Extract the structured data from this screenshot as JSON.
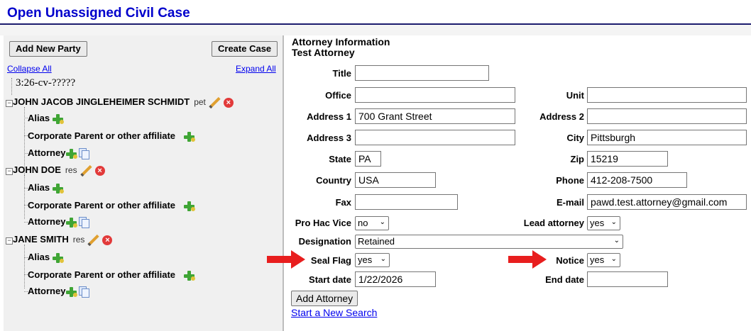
{
  "page": {
    "title": "Open Unassigned Civil Case"
  },
  "left": {
    "add_party_label": "Add New Party",
    "create_case_label": "Create Case",
    "collapse_all": "Collapse All",
    "expand_all": "Expand All",
    "case_number": "3:26-cv-?????",
    "parties": [
      {
        "name": "JOHN JACOB JINGLEHEIMER SCHMIDT",
        "role": "pet",
        "children": [
          "Alias",
          "Corporate Parent or other affiliate",
          "Attorney"
        ]
      },
      {
        "name": "JOHN DOE",
        "role": "res",
        "children": [
          "Alias",
          "Corporate Parent or other affiliate",
          "Attorney"
        ]
      },
      {
        "name": "JANE SMITH",
        "role": "res",
        "children": [
          "Alias",
          "Corporate Parent or other affiliate",
          "Attorney"
        ]
      }
    ]
  },
  "form": {
    "section_title": "Attorney Information",
    "attorney_name": "Test Attorney",
    "title_label": "Title",
    "title_value": "",
    "office_label": "Office",
    "office_value": "",
    "unit_label": "Unit",
    "unit_value": "",
    "address1_label": "Address 1",
    "address1_value": "700 Grant Street",
    "address2_label": "Address 2",
    "address2_value": "",
    "address3_label": "Address 3",
    "address3_value": "",
    "city_label": "City",
    "city_value": "Pittsburgh",
    "state_label": "State",
    "state_value": "PA",
    "zip_label": "Zip",
    "zip_value": "15219",
    "country_label": "Country",
    "country_value": "USA",
    "phone_label": "Phone",
    "phone_value": "412-208-7500",
    "fax_label": "Fax",
    "fax_value": "",
    "email_label": "E-mail",
    "email_value": "pawd.test.attorney@gmail.com",
    "pro_hac_label": "Pro Hac Vice",
    "pro_hac_value": "no",
    "lead_label": "Lead attorney",
    "lead_value": "yes",
    "designation_label": "Designation",
    "designation_value": "Retained",
    "seal_label": "Seal Flag",
    "seal_value": "yes",
    "notice_label": "Notice",
    "notice_value": "yes",
    "start_label": "Start date",
    "start_value": "1/22/2026",
    "end_label": "End date",
    "end_value": "",
    "add_attorney_label": "Add Attorney",
    "new_search_label": "Start a New Search"
  },
  "colors": {
    "title_blue": "#0000cc",
    "arrow_red": "#e81e1e",
    "link_blue": "#0000ee",
    "icon_green": "#3fa535"
  }
}
